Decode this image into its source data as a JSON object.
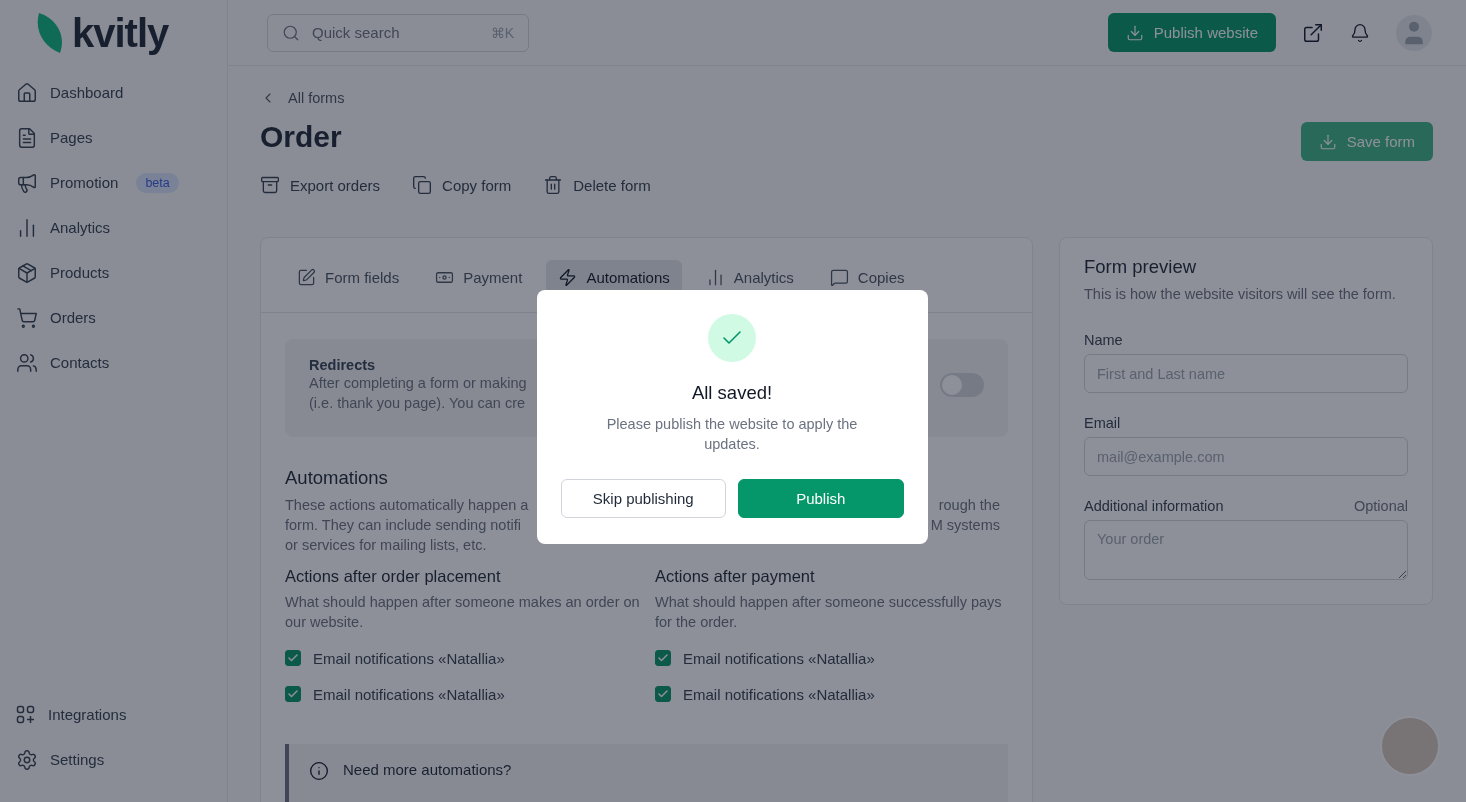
{
  "logo": {
    "text": "kvitly"
  },
  "search": {
    "placeholder": "Quick search",
    "shortcut": "⌘K"
  },
  "publish_website_button": {
    "label": "Publish website"
  },
  "sidebar": {
    "items": [
      {
        "label": "Dashboard"
      },
      {
        "label": "Pages"
      },
      {
        "label": "Promotion",
        "badge": "beta"
      },
      {
        "label": "Analytics"
      },
      {
        "label": "Products"
      },
      {
        "label": "Orders"
      },
      {
        "label": "Contacts"
      }
    ],
    "bottom_items": [
      {
        "label": "Integrations"
      },
      {
        "label": "Settings"
      }
    ]
  },
  "breadcrumb": {
    "label": "All forms"
  },
  "title": "Order",
  "save_button": {
    "label": "Save form",
    "disabled": true
  },
  "form_actions": [
    {
      "label": "Export orders"
    },
    {
      "label": "Copy form"
    },
    {
      "label": "Delete form"
    }
  ],
  "tabs": [
    {
      "label": "Form fields",
      "selected": false
    },
    {
      "label": "Payment",
      "selected": false
    },
    {
      "label": "Automations",
      "selected": true
    },
    {
      "label": "Analytics",
      "selected": false
    },
    {
      "label": "Copies",
      "selected": false
    }
  ],
  "redirects": {
    "title": "Redirects",
    "lines": [
      "After completing a form or making",
      "(i.e. thank you page). You can cre"
    ],
    "toggle_on": false
  },
  "automations": {
    "title": "Automations",
    "description_lines": [
      {
        "left": "These actions automatically happen a",
        "right": "rough the"
      },
      {
        "left": "form. They can include sending notifi",
        "right": "M systems"
      },
      {
        "left": "or services for mailing lists, etc."
      }
    ],
    "columns": [
      {
        "title": "Actions after order placement",
        "description": "What should happen after someone makes an order on our website.",
        "actions": [
          {
            "label": "Email notifications «Natallia»",
            "checked": true
          },
          {
            "label": "Email notifications «Natallia»",
            "checked": true
          }
        ]
      },
      {
        "title": "Actions after payment",
        "description": "What should happen after someone successfully pays for the order.",
        "actions": [
          {
            "label": "Email notifications «Natallia»",
            "checked": true
          },
          {
            "label": "Email notifications «Natallia»",
            "checked": true
          }
        ]
      }
    ]
  },
  "info_banner": {
    "text": "Need more automations?"
  },
  "preview": {
    "title": "Form preview",
    "description": "This is how the website visitors will see the form.",
    "fields": [
      {
        "kind": "input",
        "label": "Name",
        "placeholder": "First and Last name"
      },
      {
        "kind": "input",
        "label": "Email",
        "placeholder": "mail@example.com"
      },
      {
        "kind": "textarea",
        "label": "Additional information",
        "hint": "Optional",
        "placeholder": "Your order"
      }
    ]
  },
  "modal": {
    "title": "All saved!",
    "message": "Please publish the website to apply the updates.",
    "buttons": [
      {
        "label": "Skip publishing",
        "kind": "secondary"
      },
      {
        "label": "Publish",
        "kind": "primary"
      }
    ]
  }
}
